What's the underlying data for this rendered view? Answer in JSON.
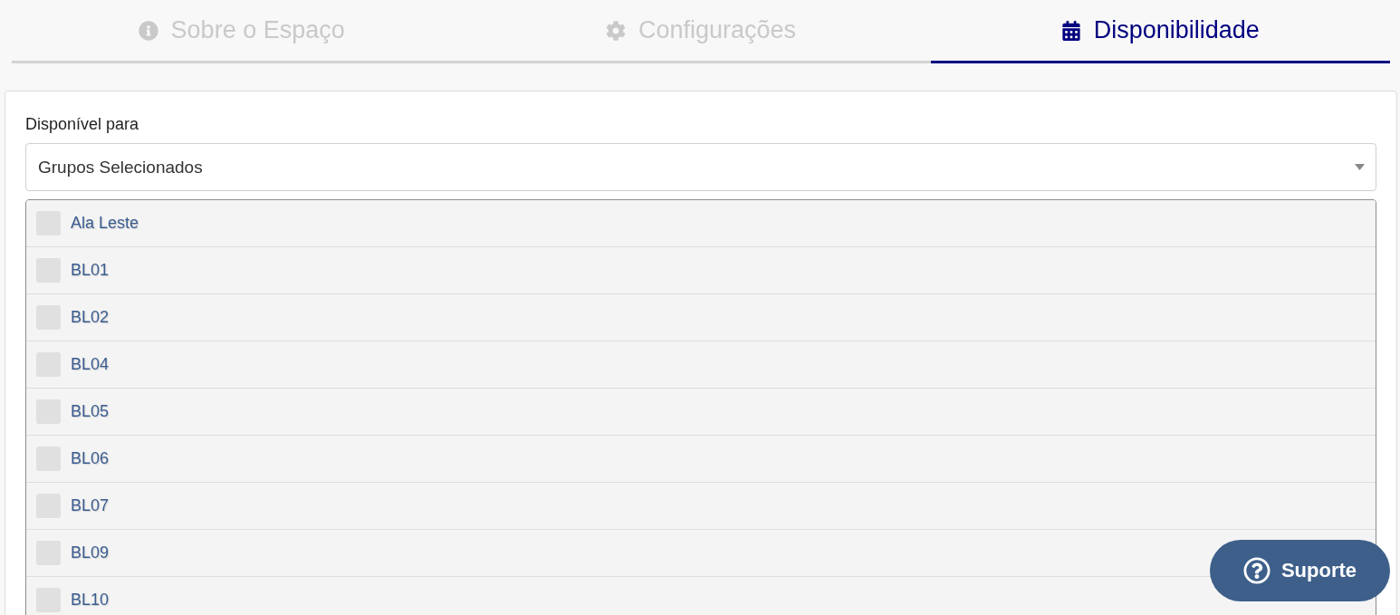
{
  "tabs": [
    {
      "label": "Sobre o Espaço",
      "selected": false
    },
    {
      "label": "Configurações",
      "selected": false
    },
    {
      "label": "Disponibilidade",
      "selected": true
    }
  ],
  "availability": {
    "label": "Disponível para",
    "value": "Grupos Selecionados"
  },
  "groups": [
    {
      "label": "Ala Leste",
      "checked": false
    },
    {
      "label": "BL01",
      "checked": false
    },
    {
      "label": "BL02",
      "checked": false
    },
    {
      "label": "BL04",
      "checked": false
    },
    {
      "label": "BL05",
      "checked": false
    },
    {
      "label": "BL06",
      "checked": false
    },
    {
      "label": "BL07",
      "checked": false
    },
    {
      "label": "BL09",
      "checked": false
    },
    {
      "label": "BL10",
      "checked": false
    }
  ],
  "support_button": {
    "label": "Suporte"
  }
}
